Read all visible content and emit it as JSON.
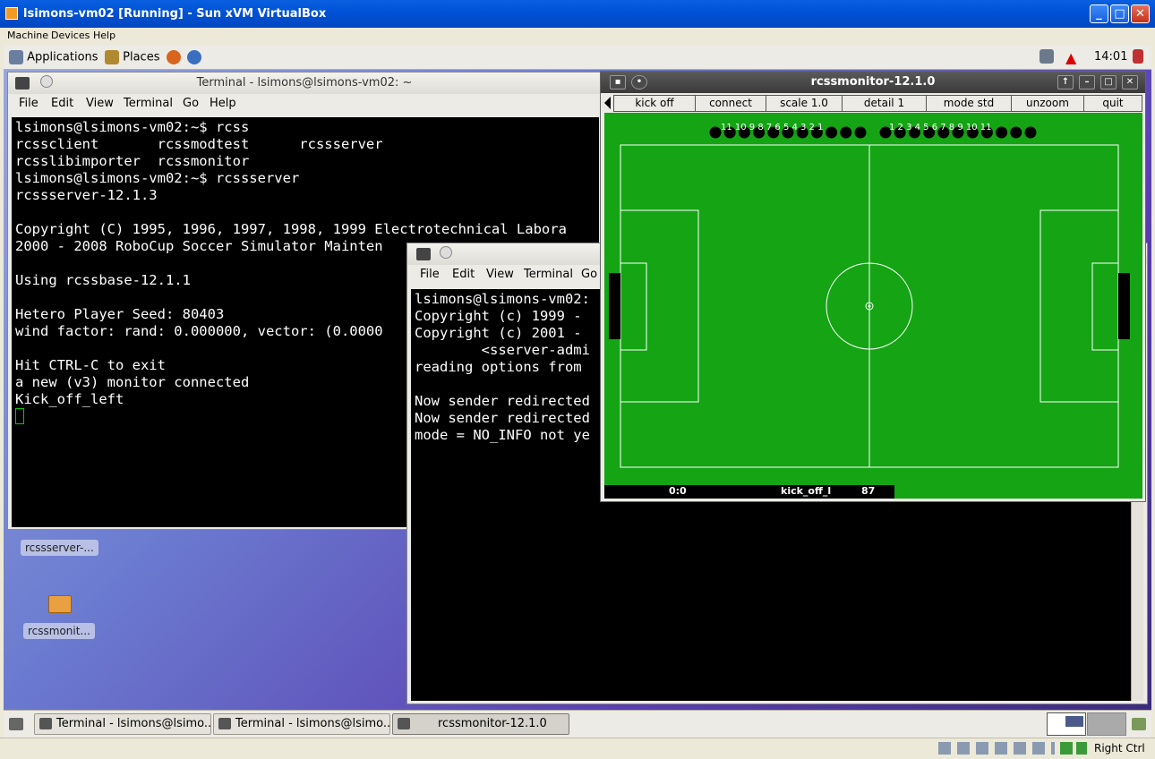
{
  "host": {
    "title": "lsimons-vm02 [Running] - Sun xVM VirtualBox",
    "menu": [
      "Machine",
      "Devices",
      "Help"
    ],
    "statusbar_label": "Right Ctrl"
  },
  "guest_panel": {
    "applications": "Applications",
    "places": "Places",
    "clock": "14:01"
  },
  "terminal1": {
    "title": "Terminal - lsimons@lsimons-vm02: ~",
    "menu": [
      "File",
      "Edit",
      "View",
      "Terminal",
      "Go",
      "Help"
    ],
    "lines": [
      "lsimons@lsimons-vm02:~$ rcss",
      "rcssclient       rcssmodtest      rcssserver",
      "rcsslibimporter  rcssmonitor",
      "lsimons@lsimons-vm02:~$ rcssserver",
      "rcssserver-12.1.3",
      "",
      "Copyright (C) 1995, 1996, 1997, 1998, 1999 Electrotechnical Labora",
      "2000 - 2008 RoboCup Soccer Simulator Mainten    e",
      "",
      "Using rcssbase-12.1.1",
      "",
      "Hetero Player Seed: 80403",
      "wind factor: rand: 0.000000, vector: (0.0000",
      "",
      "Hit CTRL-C to exit",
      "a new (v3) monitor connected",
      "Kick_off_left"
    ]
  },
  "terminal2": {
    "menu": [
      "File",
      "Edit",
      "View",
      "Terminal",
      "Go"
    ],
    "lines": [
      "lsimons@lsimons-vm02:",
      "Copyright (c) 1999 -",
      "Copyright (c) 2001 -",
      "        <sserver-admi",
      "reading options from",
      "",
      "Now sender redirected",
      "Now sender redirected",
      "mode = NO_INFO not ye"
    ]
  },
  "desktop_icons": [
    "rcssserver-...",
    "rcssmonit..."
  ],
  "monitor": {
    "title": "rcssmonitor-12.1.0",
    "buttons": [
      "kick off",
      "connect",
      "scale 1.0",
      "detail 1",
      "mode std",
      "unzoom",
      "quit"
    ],
    "left_numbers": "11 10 9  8  7  6  5  4  3  2  1",
    "right_numbers": "1  2  3  4  5  6  7  8  9  10 11",
    "score": "0:0",
    "mode": "kick_off_l",
    "time": "87",
    "colors": {
      "field": "#14a414",
      "lines": "#ffffff",
      "players": "#000000"
    }
  },
  "taskbar": [
    "Terminal - lsimons@lsimo...",
    "Terminal - lsimons@lsimo...",
    "rcssmonitor-12.1.0"
  ]
}
